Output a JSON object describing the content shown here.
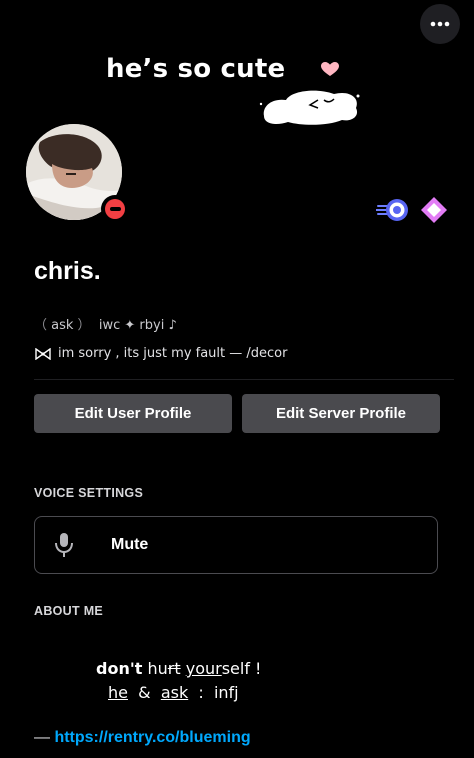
{
  "header": {
    "more_icon": "ellipsis-icon"
  },
  "banner": {
    "text": "he’s so cute",
    "heart_color": "#ffb7c2"
  },
  "profile": {
    "username": "chris.",
    "status": "do-not-disturb",
    "status_color": "#f23f43",
    "pronoun_items": [
      "ask",
      "iwc",
      "✦",
      "rbyi",
      "♪"
    ],
    "bio_icon": "ribbon-icon",
    "bio_text": "im sorry , its just my fault — /decor",
    "badges": [
      "server-boost-badge",
      "nitro-badge"
    ]
  },
  "actions": {
    "edit_user_profile": "Edit User Profile",
    "edit_server_profile": "Edit Server Profile"
  },
  "voice_settings": {
    "label": "VOICE SETTINGS",
    "mute_label": "Mute"
  },
  "about_me": {
    "label": "ABOUT ME",
    "line1": {
      "a": "don't",
      "b": " hu",
      "c": "rt",
      "d": " ",
      "e": "your",
      "f": "self  !"
    },
    "line2": {
      "a": "he",
      "b": "  &  ",
      "c": "ask",
      "d": "  :  infj"
    },
    "link_dash": "— ",
    "link": "https://rentry.co/blueming"
  },
  "colors": {
    "background": "#000000",
    "button": "#4a4a4e",
    "link": "#00a8fc"
  }
}
